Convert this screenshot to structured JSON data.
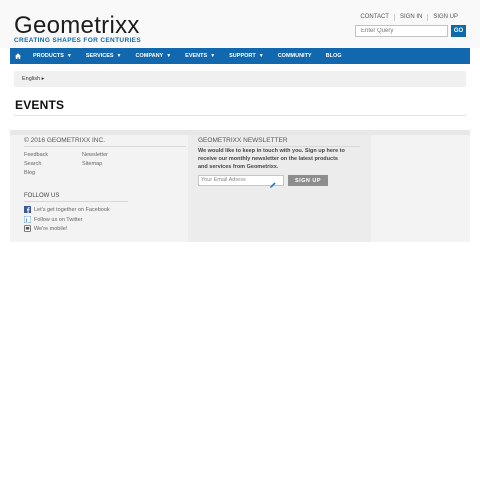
{
  "logo": {
    "word": "Geometrixx",
    "tagline": "CREATING SHAPES FOR CENTURIES"
  },
  "top_links": [
    "CONTACT",
    "SIGN IN",
    "SIGN UP"
  ],
  "search": {
    "placeholder": "Enter Query",
    "button": "GO"
  },
  "nav": {
    "home_icon": "home-icon",
    "items": [
      {
        "label": "PRODUCTS",
        "dropdown": true
      },
      {
        "label": "SERVICES",
        "dropdown": true
      },
      {
        "label": "COMPANY",
        "dropdown": true
      },
      {
        "label": "EVENTS",
        "dropdown": true
      },
      {
        "label": "SUPPORT",
        "dropdown": true
      },
      {
        "label": "COMMUNITY",
        "dropdown": false
      },
      {
        "label": "BLOG",
        "dropdown": false
      }
    ]
  },
  "language": {
    "label": "English",
    "caret": "▸"
  },
  "page_title": "EVENTS",
  "footer": {
    "copyright": "© 2016 GEOMETRIXX INC.",
    "links_col1": [
      "Feedback",
      "Search",
      "Blog"
    ],
    "links_col2": [
      "Newsletter",
      "Sitemap"
    ],
    "follow_heading": "FOLLOW US",
    "social": [
      {
        "icon": "facebook-icon",
        "label": "Let's get together on Facebook"
      },
      {
        "icon": "twitter-icon",
        "label": "Follow us on Twitter"
      },
      {
        "icon": "mobile-icon",
        "label": "We're mobile!"
      }
    ],
    "newsletter": {
      "heading": "GEOMETRIXX NEWSLETTER",
      "text": "We would like to keep in touch with you. Sign up here to receive our monthly newsletter on the latest products and services from Geometrixx.",
      "email_placeholder": "Your Email Adress",
      "button": "SIGN UP"
    }
  },
  "colors": {
    "brand_blue": "#1268ae",
    "signup_button": "#8d8d8d"
  }
}
